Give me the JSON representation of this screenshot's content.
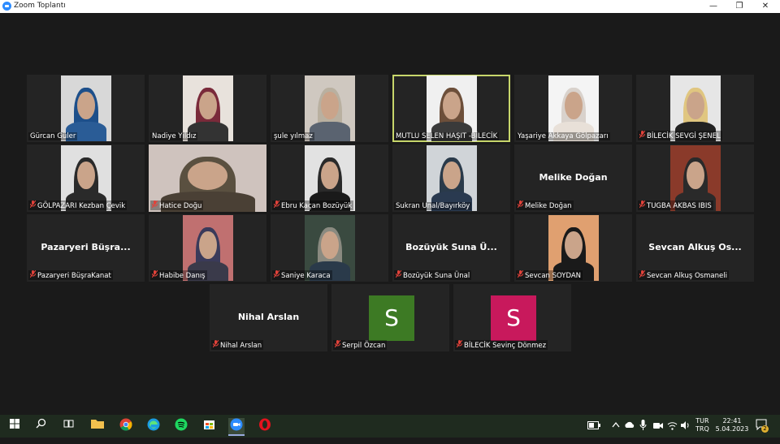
{
  "window": {
    "title": "Zoom Toplantı",
    "minimize": "—",
    "maximize": "❐",
    "close": "✕"
  },
  "participants": [
    {
      "name": "Gürcan Güler",
      "muted": false,
      "video": true,
      "scarf": "#1d4f8a",
      "body": "#2a5c96",
      "bg": "#d8d8d8"
    },
    {
      "name": "Nadiye Yıldız",
      "muted": false,
      "video": true,
      "scarf": "#7a2a3a",
      "body": "#333",
      "bg": "#e8e2dc"
    },
    {
      "name": "şule yılmaz",
      "muted": false,
      "video": true,
      "scarf": "#b9b0a0",
      "body": "#5a6370",
      "bg": "#cfc8c0"
    },
    {
      "name": "MUTLU SELEN HAŞIT -BİLECİK",
      "muted": false,
      "video": true,
      "speaking": true,
      "scarf": "#6d4f3a",
      "body": "#3a3a3a",
      "bg": "#f0f0f0"
    },
    {
      "name": "Yaşariye Akkaya Gölpazarı",
      "muted": false,
      "video": true,
      "scarf": "#d9d2cc",
      "body": "#e8e0d8",
      "bg": "#f4f4f4"
    },
    {
      "name": "BİLECİK SEVGİ ŞENEL",
      "muted": true,
      "video": true,
      "scarf": "#e0c680",
      "body": "#222",
      "bg": "#e6e6e6"
    },
    {
      "name": "GÖLPAZARI  Kezban Çevik",
      "muted": true,
      "video": true,
      "scarf": "#2a2a2a",
      "body": "#2a2a2a",
      "bg": "#e0e0e0"
    },
    {
      "name": "Hatice Doğu",
      "muted": true,
      "video": true,
      "scarf": "#5a5040",
      "body": "#4a4035",
      "bg": "#cfc3be"
    },
    {
      "name": "Ebru Kaçan Bozüyük",
      "muted": true,
      "video": true,
      "scarf": "#2a2a2a",
      "body": "#1a1a1a",
      "bg": "#e2e2e2"
    },
    {
      "name": "Sukran Unal/Bayırköy",
      "muted": false,
      "video": true,
      "scarf": "#2a3a4a",
      "body": "#2a3a50",
      "bg": "#d0d4d8"
    },
    {
      "name": "Melike Doğan",
      "muted": true,
      "video": false,
      "big": "Melike Doğan"
    },
    {
      "name": "TUGBA AKBAS IBIS",
      "muted": true,
      "video": true,
      "scarf": "#2a2a2a",
      "body": "#2a2a2a",
      "bg": "#8a3a2a"
    },
    {
      "name": "Pazaryeri BüşraKanat",
      "muted": true,
      "video": false,
      "big": "Pazaryeri  Büşra..."
    },
    {
      "name": "Habibe Danış",
      "muted": true,
      "video": true,
      "scarf": "#3a3a5a",
      "body": "#3a3a4a",
      "bg": "#c07070"
    },
    {
      "name": "Saniye Karaca",
      "muted": true,
      "video": true,
      "scarf": "#8a8a80",
      "body": "#2a3a4a",
      "bg": "#3a4a40"
    },
    {
      "name": "Bozüyük Suna Ünal",
      "muted": true,
      "video": false,
      "big": "Bozüyük Suna Ü..."
    },
    {
      "name": "Sevcan SOYDAN",
      "muted": true,
      "video": true,
      "scarf": "#1a1a1a",
      "body": "#1a1a1a",
      "bg": "#e0a070"
    },
    {
      "name": "Sevcan Alkuş Osmaneli",
      "muted": true,
      "video": false,
      "big": "Sevcan  Alkuş  Os..."
    },
    {
      "name": "Nihal Arslan",
      "muted": true,
      "video": false,
      "big": "Nihal Arslan"
    },
    {
      "name": "Serpil Özcan",
      "muted": true,
      "video": false,
      "avatar": "S",
      "avatar_color": "#3d7a24"
    },
    {
      "name": "BİLECİK Sevinç Dönmez",
      "muted": true,
      "video": false,
      "avatar": "S",
      "avatar_color": "#c8195c"
    }
  ],
  "taskbar": {
    "apps": [
      "start",
      "search",
      "task-view",
      "file-explorer",
      "chrome",
      "edge",
      "spotify",
      "store",
      "zoom",
      "opera"
    ],
    "language": "TUR",
    "layout": "TRQ",
    "time": "22:41",
    "date": "5.04.2023",
    "notifications": "2"
  }
}
